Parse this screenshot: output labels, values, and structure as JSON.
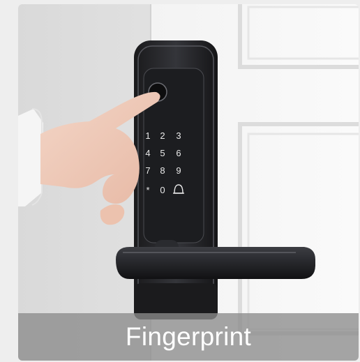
{
  "card": {
    "caption": "Fingerprint",
    "keypad": {
      "keys": [
        "1",
        "2",
        "3",
        "4",
        "5",
        "6",
        "7",
        "8",
        "9",
        "*",
        "0",
        "#"
      ]
    }
  }
}
